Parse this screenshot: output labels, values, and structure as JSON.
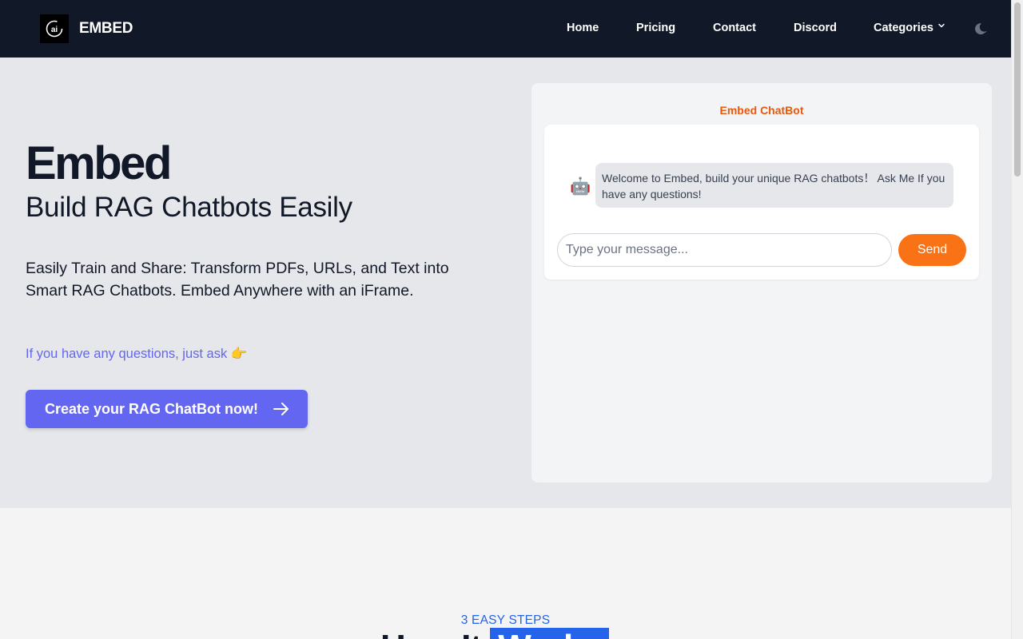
{
  "nav": {
    "brand": "EMBED",
    "links": [
      "Home",
      "Pricing",
      "Contact",
      "Discord",
      "Categories"
    ]
  },
  "hero": {
    "title": "Embed",
    "subtitle": "Build RAG Chatbots Easily",
    "description": "Easily Train and Share: Transform PDFs, URLs, and Text into Smart RAG Chatbots. Embed Anywhere with an iFrame.",
    "ask": "If you have any questions, just ask 👉",
    "cta_label": "Create your RAG ChatBot now!"
  },
  "chatbot": {
    "title": "Embed ChatBot",
    "avatar": "🤖",
    "welcome_message": "Welcome to Embed, build your unique RAG chatbots！ Ask Me If you have any questions!",
    "input_placeholder": "Type your message...",
    "input_value": "",
    "send_label": "Send"
  },
  "steps": {
    "eyebrow": "3 EASY STEPS",
    "heading_prefix": "How It ",
    "heading_highlight": "Works"
  },
  "colors": {
    "navbar_bg": "#111827",
    "accent_indigo": "#6366f1",
    "send_orange": "#f97316",
    "chat_title_orange": "#ea580c",
    "steps_blue": "#2563eb"
  },
  "icons": {
    "logo": "ai-logo-icon",
    "categories": "chevron-down-icon",
    "theme": "moon-icon",
    "cta": "arrow-right-icon"
  }
}
